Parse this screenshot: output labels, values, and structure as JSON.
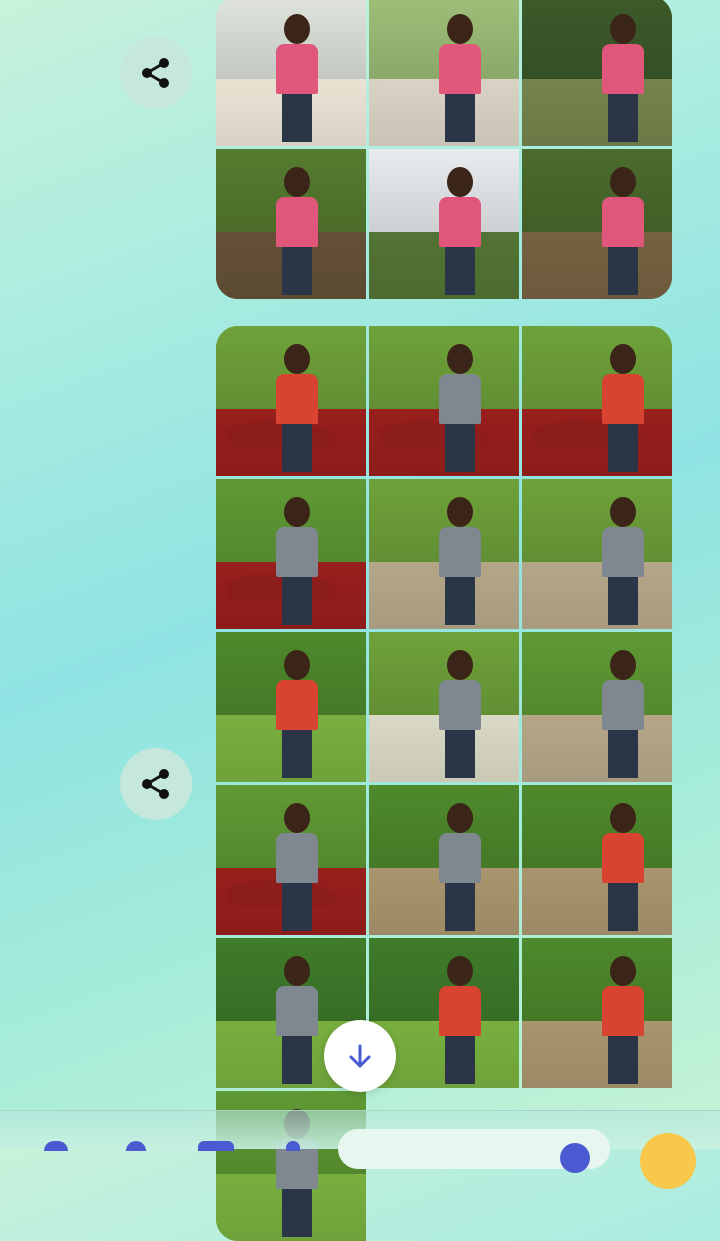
{
  "thread": {
    "share_icon": "share-icon",
    "scroll_down_icon": "arrow-down-icon",
    "album_1": {
      "photos": [
        {
          "palette": [
            "#dfe3dc",
            "#d9d2c4",
            "#e0577b"
          ]
        },
        {
          "palette": [
            "#9fbf78",
            "#c9c3b6",
            "#e0577b"
          ]
        },
        {
          "palette": [
            "#3d5a2a",
            "#6b7a46",
            "#e0577b"
          ]
        },
        {
          "palette": [
            "#567c2f",
            "#5c4a32",
            "#e0577b"
          ]
        },
        {
          "palette": [
            "#e8ecef",
            "#4d6b30",
            "#e0577b"
          ]
        },
        {
          "palette": [
            "#4b6b2c",
            "#6d5a3c",
            "#e0577b"
          ]
        }
      ]
    },
    "album_2": {
      "photos": [
        {
          "palette": [
            "#6fa23a",
            "#8d1d1a",
            "#d94432"
          ]
        },
        {
          "palette": [
            "#6fa23a",
            "#8d1d1a",
            "#7f8890"
          ]
        },
        {
          "palette": [
            "#6fa23a",
            "#8d1d1a",
            "#d94432"
          ]
        },
        {
          "palette": [
            "#5f9a34",
            "#8d1d1a",
            "#7f8890"
          ]
        },
        {
          "palette": [
            "#6fa23a",
            "#a89a7e",
            "#7f8890"
          ]
        },
        {
          "palette": [
            "#6fa23a",
            "#a89a7e",
            "#7f8890"
          ]
        },
        {
          "palette": [
            "#4e8a2c",
            "#6fa23a",
            "#d94432"
          ]
        },
        {
          "palette": [
            "#6fa23a",
            "#c9c9b6",
            "#7f8890"
          ]
        },
        {
          "palette": [
            "#5f9a34",
            "#a89a7e",
            "#7f8890"
          ]
        },
        {
          "palette": [
            "#5f9a34",
            "#8d1d1a",
            "#7f8890"
          ]
        },
        {
          "palette": [
            "#4e8a2c",
            "#9c8a66",
            "#7f8890"
          ]
        },
        {
          "palette": [
            "#4e8a2c",
            "#9c8a66",
            "#d94432"
          ]
        },
        {
          "palette": [
            "#3f7c2a",
            "#6fa23a",
            "#7f8890"
          ]
        },
        {
          "palette": [
            "#3f7c2a",
            "#6fa23a",
            "#d94432"
          ]
        },
        {
          "palette": [
            "#4e8a2c",
            "#9c8a66",
            "#d94432"
          ]
        },
        {
          "palette": [
            "#5f9a34",
            "#6fa23a",
            "#7f8890"
          ]
        }
      ]
    }
  },
  "bottom_bar": {
    "icons": [
      "add-icon",
      "camera-icon",
      "gallery-icon",
      "mic-icon",
      "emoji-icon"
    ]
  }
}
